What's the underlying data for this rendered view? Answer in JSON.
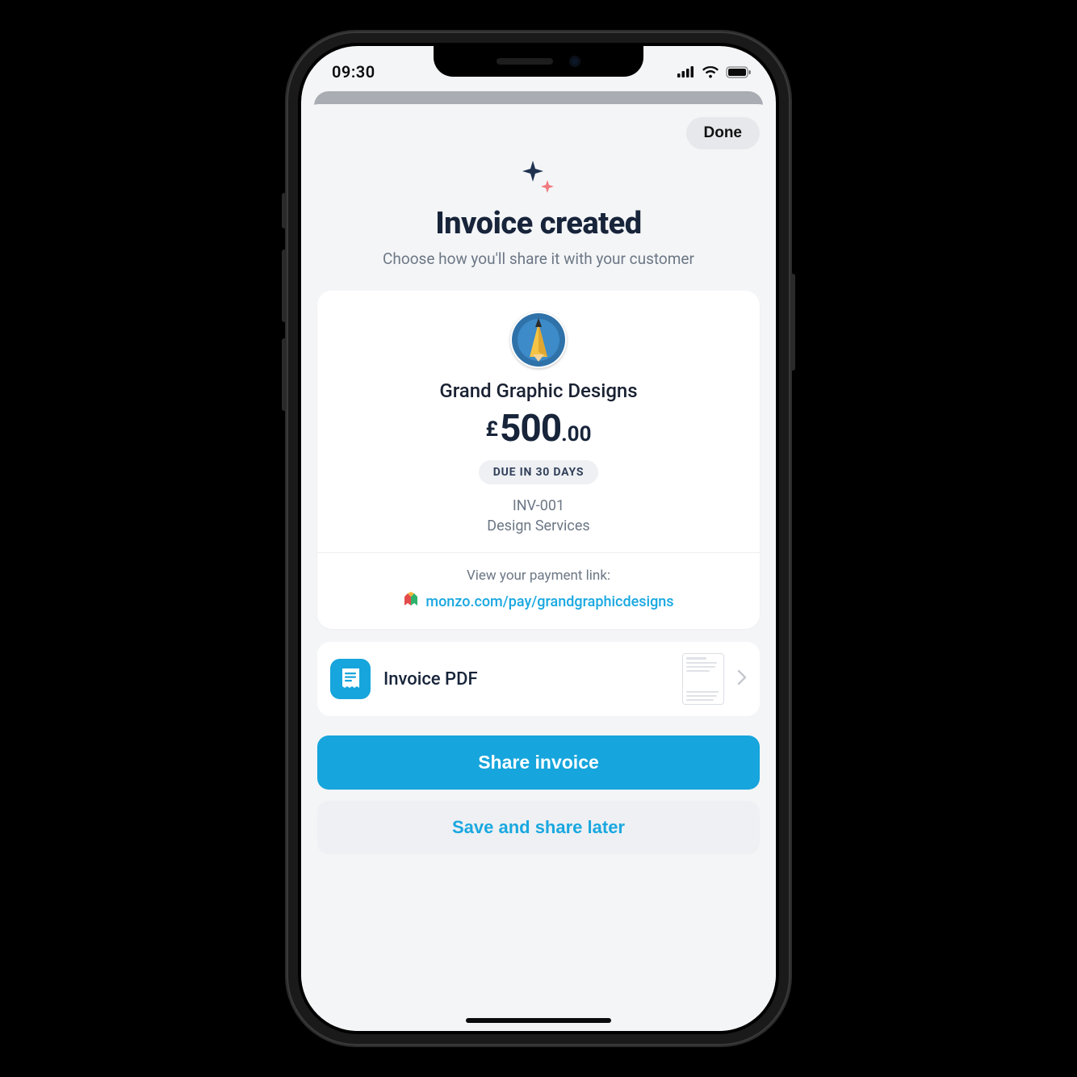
{
  "statusbar": {
    "time": "09:30"
  },
  "sheet": {
    "done_label": "Done",
    "title": "Invoice created",
    "subtitle": "Choose how you'll share it with your customer"
  },
  "invoice": {
    "customer_name": "Grand Graphic Designs",
    "currency_symbol": "£",
    "amount_major": "500",
    "amount_minor": "00",
    "due_badge": "DUE IN 30 DAYS",
    "invoice_number": "INV-001",
    "description": "Design Services",
    "payment_link_label": "View your payment link:",
    "payment_link_text": "monzo.com/pay/grandgraphicdesigns"
  },
  "pdf_row": {
    "label": "Invoice PDF"
  },
  "actions": {
    "primary": "Share invoice",
    "secondary": "Save and share later"
  }
}
